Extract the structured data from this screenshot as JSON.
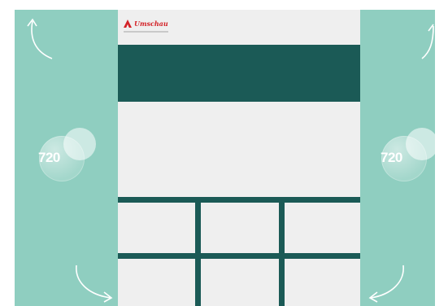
{
  "colors": {
    "mint_background": "#8fcec0",
    "dark_teal": "#1b5a56",
    "page_background": "#efefef",
    "brand_red": "#d32227"
  },
  "logo": {
    "icon": "apotheke-a-icon",
    "brand_name": "Umschau"
  },
  "badges": {
    "left_text": "720",
    "right_text": "720"
  },
  "arrows": {
    "top_left": "curved-arrow-up-icon",
    "top_right": "curved-arrow-up-icon",
    "bottom_left": "curved-arrow-down-icon",
    "bottom_right": "curved-arrow-down-icon"
  }
}
